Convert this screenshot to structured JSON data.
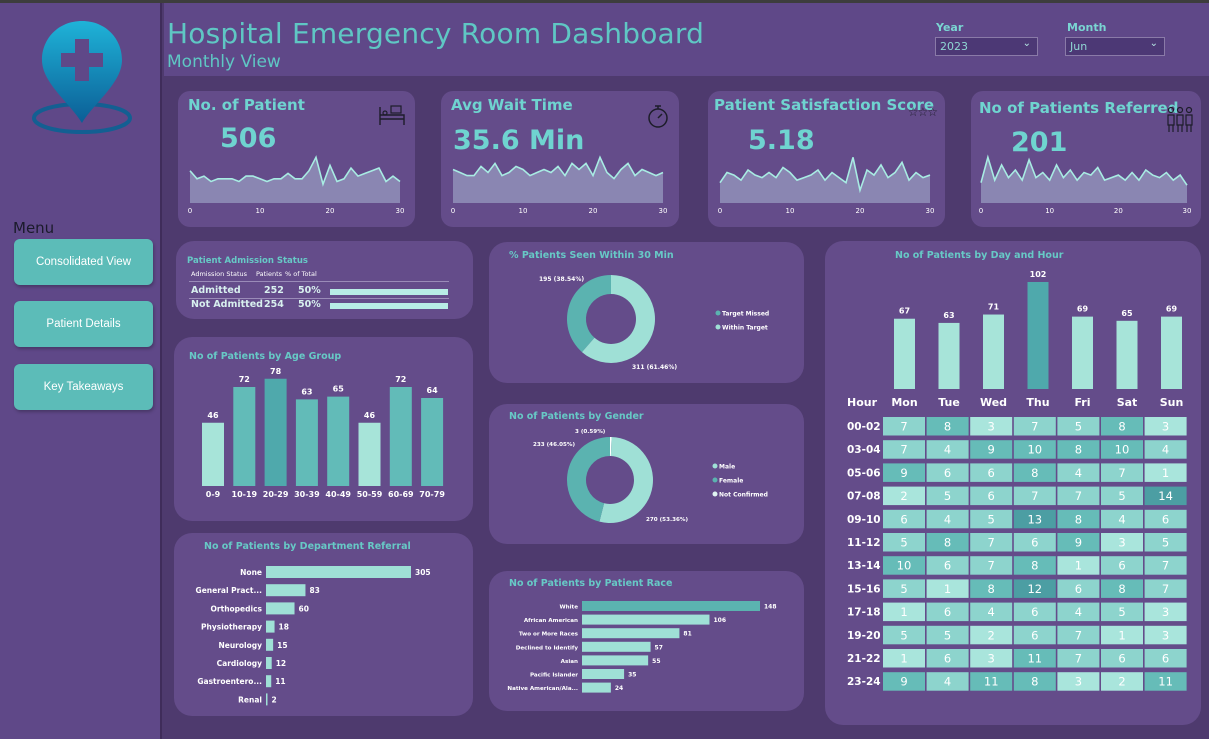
{
  "header": {
    "title": "Hospital Emergency Room Dashboard",
    "subtitle": "Monthly View"
  },
  "filters": {
    "year_label": "Year",
    "year_value": "2023",
    "month_label": "Month",
    "month_value": "Jun"
  },
  "menu": {
    "label": "Menu",
    "items": [
      {
        "label": "Consolidated View"
      },
      {
        "label": "Patient Details"
      },
      {
        "label": "Key Takeaways"
      }
    ]
  },
  "kpis": [
    {
      "title": "No. of Patient",
      "value": "506",
      "icon": "hospital-bed-icon",
      "ticks": [
        "0",
        "10",
        "20",
        "30"
      ],
      "series": [
        12,
        9,
        10,
        8,
        9,
        9,
        9,
        8,
        10,
        10,
        9,
        8,
        9,
        9,
        11,
        9,
        9,
        12,
        17,
        7,
        14,
        8,
        9,
        13,
        10,
        11,
        12,
        13,
        8,
        10,
        8
      ]
    },
    {
      "title": "Avg Wait Time",
      "value": "35.6 Min",
      "icon": "stopwatch-icon",
      "ticks": [
        "0",
        "10",
        "20",
        "30"
      ],
      "series": [
        11,
        10,
        9,
        9,
        12,
        10,
        13,
        9,
        10,
        12,
        11,
        9,
        10,
        11,
        10,
        12,
        9,
        13,
        11,
        13,
        9,
        15,
        10,
        8,
        11,
        13,
        9,
        11,
        10,
        9,
        10
      ]
    },
    {
      "title": "Patient Satisfaction Score",
      "value": "5.18",
      "icon": "stars-icon",
      "ticks": [
        "0",
        "10",
        "20",
        "30"
      ],
      "series": [
        8,
        12,
        11,
        9,
        13,
        11,
        10,
        12,
        10,
        14,
        12,
        9,
        10,
        11,
        13,
        9,
        12,
        10,
        8,
        18,
        5,
        13,
        11,
        15,
        10,
        12,
        16,
        9,
        12,
        10,
        11
      ]
    },
    {
      "title": "No of Patients Referred",
      "value": "201",
      "icon": "people-group-icon",
      "ticks": [
        "0",
        "10",
        "20",
        "30"
      ],
      "series": [
        8,
        18,
        9,
        15,
        10,
        13,
        9,
        17,
        10,
        12,
        9,
        15,
        10,
        13,
        9,
        12,
        11,
        14,
        9,
        10,
        11,
        9,
        12,
        9,
        13,
        11,
        10,
        12,
        9,
        11,
        7
      ]
    }
  ],
  "admission": {
    "title": "Patient Admission Status",
    "headers": [
      "Admission Status",
      "Patients",
      "% of Total"
    ],
    "rows": [
      {
        "status": "Admitted",
        "patients": "252",
        "pct": "50%",
        "fraction": 0.5
      },
      {
        "status": "Not Admitted",
        "patients": "254",
        "pct": "50%",
        "fraction": 0.5
      }
    ]
  },
  "chart_data": [
    {
      "id": "age",
      "type": "bar",
      "title": "No of Patients by Age Group",
      "categories": [
        "0-9",
        "10-19",
        "20-29",
        "30-39",
        "40-49",
        "50-59",
        "60-69",
        "70-79"
      ],
      "values": [
        46,
        72,
        78,
        63,
        65,
        46,
        72,
        64
      ],
      "colors": [
        "#a7e4d9",
        "#62bbb8",
        "#4fa9ac",
        "#62bbb8",
        "#62bbb8",
        "#a7e4d9",
        "#62bbb8",
        "#62bbb8"
      ]
    },
    {
      "id": "seen30",
      "type": "pie",
      "title": "% Patients Seen Within 30 Min",
      "slices": [
        {
          "name": "Target Missed",
          "value": 38.54,
          "label": "195 (38.54%)"
        },
        {
          "name": "Within Target",
          "value": 61.46,
          "label": "311 (61.46%)"
        }
      ],
      "colors": [
        "#5bb3b0",
        "#9fe0d6"
      ],
      "legend": [
        "Target Missed",
        "Within Target"
      ]
    },
    {
      "id": "gender",
      "type": "pie",
      "title": "No of Patients by Gender",
      "slices": [
        {
          "name": "Not Confirmed",
          "value": 0.59,
          "label": "3 (0.59%)"
        },
        {
          "name": "Male",
          "value": 53.36,
          "label": "270 (53.36%)"
        },
        {
          "name": "Female",
          "value": 46.05,
          "label": "233 (46.05%)"
        }
      ],
      "colors": [
        "#ffffff",
        "#9fe0d6",
        "#5bb3b0"
      ],
      "legend": [
        "Male",
        "Female",
        "Not Confirmed"
      ],
      "legend_colors": [
        "#9fe0d6",
        "#5bb3b0",
        "#e0f5f2"
      ]
    },
    {
      "id": "dept",
      "type": "bar",
      "orientation": "horizontal",
      "title": "No of Patients by Department Referral",
      "categories": [
        "None",
        "General Pract...",
        "Orthopedics",
        "Physiotherapy",
        "Neurology",
        "Cardiology",
        "Gastroentero...",
        "Renal"
      ],
      "values": [
        305,
        83,
        60,
        18,
        15,
        12,
        11,
        2
      ]
    },
    {
      "id": "race",
      "type": "bar",
      "orientation": "horizontal",
      "title": "No of Patients by Patient Race",
      "categories": [
        "White",
        "African American",
        "Two or More Races",
        "Declined to Identify",
        "Asian",
        "Pacific Islander",
        "Native American/Ala..."
      ],
      "values": [
        148,
        106,
        81,
        57,
        55,
        35,
        24
      ]
    },
    {
      "id": "daybar",
      "type": "bar",
      "title": "No of Patients by Day and Hour",
      "categories": [
        "Mon",
        "Tue",
        "Wed",
        "Thu",
        "Fri",
        "Sat",
        "Sun"
      ],
      "values": [
        67,
        63,
        71,
        102,
        69,
        65,
        69
      ],
      "colors": [
        "#a7e4d9",
        "#a7e4d9",
        "#a7e4d9",
        "#4fa9ac",
        "#a7e4d9",
        "#a7e4d9",
        "#a7e4d9"
      ]
    },
    {
      "id": "heatmap",
      "type": "heatmap",
      "row_header": "Hour",
      "rows": [
        "00-02",
        "03-04",
        "05-06",
        "07-08",
        "09-10",
        "11-12",
        "13-14",
        "15-16",
        "17-18",
        "19-20",
        "21-22",
        "23-24"
      ],
      "columns": [
        "Mon",
        "Tue",
        "Wed",
        "Thu",
        "Fri",
        "Sat",
        "Sun"
      ],
      "values": [
        [
          7,
          8,
          3,
          7,
          5,
          8,
          3
        ],
        [
          7,
          4,
          9,
          10,
          8,
          10,
          4
        ],
        [
          9,
          6,
          6,
          8,
          4,
          7,
          1
        ],
        [
          2,
          5,
          6,
          7,
          7,
          5,
          14
        ],
        [
          6,
          4,
          5,
          13,
          8,
          4,
          6
        ],
        [
          5,
          8,
          7,
          6,
          9,
          3,
          5
        ],
        [
          10,
          6,
          7,
          8,
          1,
          6,
          7
        ],
        [
          5,
          1,
          8,
          12,
          6,
          8,
          7
        ],
        [
          1,
          6,
          4,
          6,
          4,
          5,
          3
        ],
        [
          5,
          5,
          2,
          6,
          7,
          1,
          3
        ],
        [
          1,
          6,
          3,
          11,
          7,
          6,
          6
        ],
        [
          9,
          4,
          11,
          8,
          3,
          2,
          11
        ]
      ]
    }
  ]
}
